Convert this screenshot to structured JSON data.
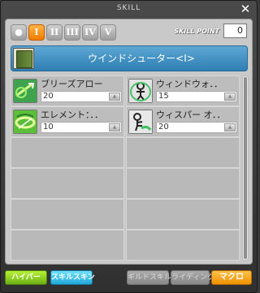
{
  "window": {
    "title": "SKILL"
  },
  "tabs": [
    {
      "label": "●"
    },
    {
      "label": "I"
    },
    {
      "label": "II"
    },
    {
      "label": "III"
    },
    {
      "label": "IV"
    },
    {
      "label": "V"
    }
  ],
  "active_tab": 1,
  "skill_point": {
    "label": "SKILL POINT",
    "value": "0"
  },
  "job": {
    "name": "ウインドシューター<I>"
  },
  "skills": [
    {
      "name": "ブリーズアロー",
      "level": "20",
      "icon": "arrow-wind-icon"
    },
    {
      "name": "ウィンドウォ．．",
      "level": "15",
      "icon": "figure-wind-icon"
    },
    {
      "name": "エレメント：．．",
      "level": "10",
      "icon": "element-icon"
    },
    {
      "name": "ウィスパー オ．．",
      "level": "20",
      "icon": "whisper-icon"
    }
  ],
  "bottom_buttons": {
    "hyper": "ハイパー",
    "skin": "スキルスキン",
    "guild": "ギルドスキル",
    "ride": "ライディング",
    "macro": "マクロ"
  },
  "colors": {
    "accent": "#f07a00",
    "job_bar": "#2e7fb3",
    "hyper": "#6cb014",
    "skin": "#21a9d8"
  }
}
